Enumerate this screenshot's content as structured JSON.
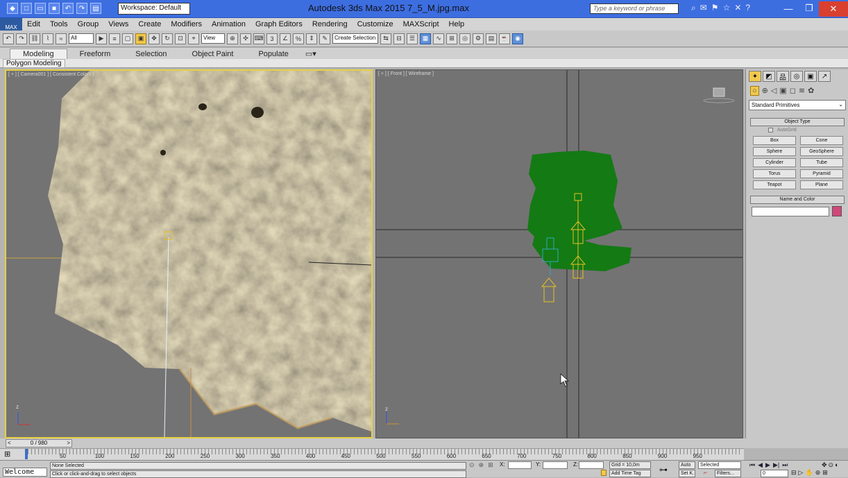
{
  "window": {
    "title": "Autodesk 3ds Max 2015    7_5_M.jpg.max",
    "workspace": "Workspace: Default",
    "search_placeholder": "Type a keyword or phrase",
    "logo": "MAX"
  },
  "menu": [
    "Edit",
    "Tools",
    "Group",
    "Views",
    "Create",
    "Modifiers",
    "Animation",
    "Graph Editors",
    "Rendering",
    "Customize",
    "MAXScript",
    "Help"
  ],
  "toolbar": {
    "filter_value": "All",
    "refcoord_value": "View",
    "selection_set_value": "Create Selection Se"
  },
  "ribbon": {
    "tabs": [
      "Modeling",
      "Freeform",
      "Selection",
      "Object Paint",
      "Populate"
    ],
    "active": "Modeling",
    "subpanel": "Polygon Modeling"
  },
  "viewports": {
    "left_label": "[ + ] [ Camera001 ] [ Consistent Colors ]",
    "right_label": "[ + ] [ Front ] [ Wireframe ]",
    "axis_z": "z"
  },
  "command_panel": {
    "category": "Standard Primitives",
    "object_type_title": "Object Type",
    "autogrid_label": "AutoGrid",
    "buttons": [
      "Box",
      "Cone",
      "Sphere",
      "GeoSphere",
      "Cylinder",
      "Tube",
      "Torus",
      "Pyramid",
      "Teapot",
      "Plane"
    ],
    "name_color_title": "Name and Color",
    "color": "#d0487a"
  },
  "timeline": {
    "frame_counter": "0 / 980",
    "ticks": [
      "50",
      "100",
      "150",
      "200",
      "250",
      "300",
      "350",
      "400",
      "450",
      "500",
      "550",
      "600",
      "650",
      "700",
      "750",
      "800",
      "850",
      "900",
      "950"
    ]
  },
  "status": {
    "maxscript_listener": "Welcome tc",
    "selection_status": "None Selected",
    "prompt": "Click or click-and-drag to select objects",
    "x_label": "X:",
    "y_label": "Y:",
    "z_label": "Z:",
    "grid": "Grid = 10,0m",
    "add_time_tag": "Add Time Tag",
    "auto_label": "Auto",
    "set_key_label": "Set K.",
    "selected_value": "Selected",
    "filters_label": "Filters...",
    "frame_value": "0"
  },
  "colors": {
    "titlebar": "#3d6ee0",
    "active_viewport_border": "#e8d040",
    "plane_green": "#147a14",
    "helper_yellow": "#e8c020",
    "helper_cyan": "#30a8b8"
  }
}
